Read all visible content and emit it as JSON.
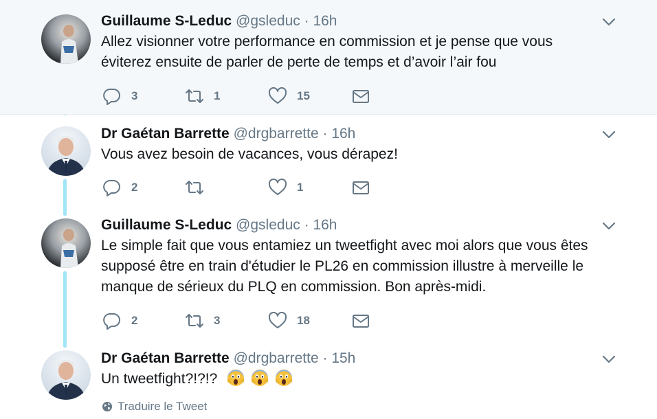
{
  "tweets": [
    {
      "name": "Guillaume S-Leduc",
      "handle": "@gsleduc",
      "sep": "·",
      "time": "16h",
      "avatar": "guillaume-avatar",
      "lines": [
        "Allez visionner votre performance en commission et je pense que vous",
        "éviterez ensuite de parler de perte de temps et d’avoir l’air fou"
      ],
      "replies": "3",
      "retweets": "1",
      "likes": "15"
    },
    {
      "name": "Dr Gaétan Barrette",
      "handle": "@drgbarrette",
      "sep": "·",
      "time": "16h",
      "avatar": "gaetan-avatar",
      "lines": [
        "Vous avez besoin de vacances, vous dérapez!"
      ],
      "replies": "2",
      "retweets": "",
      "likes": "1"
    },
    {
      "name": "Guillaume S-Leduc",
      "handle": "@gsleduc",
      "sep": "·",
      "time": "16h",
      "avatar": "guillaume-avatar",
      "lines": [
        "Le simple fait que vous entamiez un tweetfight avec moi alors que vous êtes",
        "supposé être en train d'étudier le PL26 en commission illustre à merveille le",
        "manque de sérieux du PLQ en commission. Bon après-midi."
      ],
      "replies": "2",
      "retweets": "3",
      "likes": "18"
    },
    {
      "name": "Dr Gaétan Barrette",
      "handle": "@drgbarrette",
      "sep": "·",
      "time": "15h",
      "avatar": "gaetan-avatar",
      "text": "Un tweetfight?!?!?",
      "emoji": "face-screaming-in-fear"
    }
  ],
  "translate_label": "Traduire le Tweet",
  "colors": {
    "highlight_bg": "#f5f8fa",
    "thread_line": "#a2e4f8",
    "secondary_text": "#657786"
  },
  "icons": [
    "reply-icon",
    "retweet-icon",
    "like-icon",
    "dm-icon",
    "chevron-down-icon",
    "globe-icon"
  ]
}
